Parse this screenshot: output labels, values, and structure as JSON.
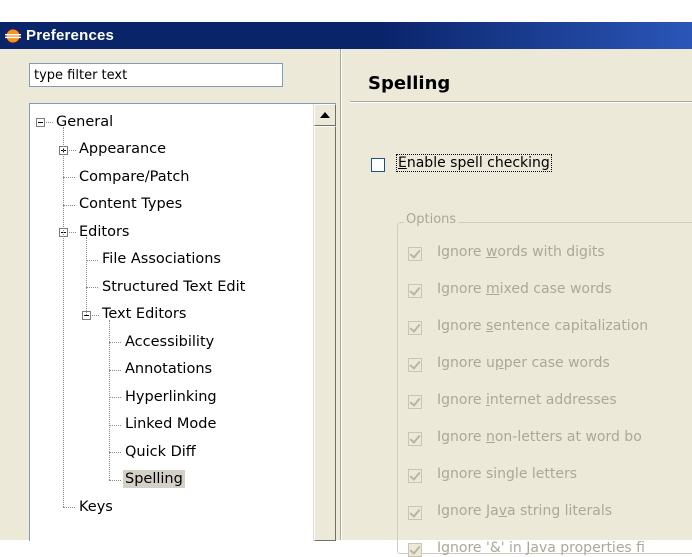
{
  "window": {
    "title": "Preferences",
    "icon": "eclipse-icon"
  },
  "filter": {
    "value": "type filter text"
  },
  "tree": [
    {
      "label": "General",
      "expander": "minus",
      "indent": 0
    },
    {
      "label": "Appearance",
      "expander": "plus",
      "indent": 1
    },
    {
      "label": "Compare/Patch",
      "expander": "none",
      "indent": 1
    },
    {
      "label": "Content Types",
      "expander": "none",
      "indent": 1
    },
    {
      "label": "Editors",
      "expander": "minus",
      "indent": 1
    },
    {
      "label": "File Associations",
      "expander": "none",
      "indent": 2
    },
    {
      "label": "Structured Text Edit",
      "expander": "none",
      "indent": 2
    },
    {
      "label": "Text Editors",
      "expander": "minus",
      "indent": 2
    },
    {
      "label": "Accessibility",
      "expander": "none",
      "indent": 3
    },
    {
      "label": "Annotations",
      "expander": "none",
      "indent": 3
    },
    {
      "label": "Hyperlinking",
      "expander": "none",
      "indent": 3
    },
    {
      "label": "Linked Mode",
      "expander": "none",
      "indent": 3
    },
    {
      "label": "Quick Diff",
      "expander": "none",
      "indent": 3
    },
    {
      "label": "Spelling",
      "expander": "none",
      "indent": 3,
      "selected": true
    },
    {
      "label": "Keys",
      "expander": "none",
      "indent": 1
    }
  ],
  "page": {
    "title": "Spelling",
    "enable": {
      "label": "Enable spell checking",
      "mnemonic": "E",
      "checked": false
    },
    "options_group": "Options",
    "options": [
      {
        "pre": "Ignore ",
        "mn": "w",
        "post": "ords with digits",
        "checked": true
      },
      {
        "pre": "Ignore ",
        "mn": "m",
        "post": "ixed case words",
        "checked": true
      },
      {
        "pre": "Ignore ",
        "mn": "s",
        "post": "entence capitalization",
        "checked": true
      },
      {
        "pre": "Ignore u",
        "mn": "p",
        "post": "per case words",
        "checked": true
      },
      {
        "pre": "Ignore ",
        "mn": "i",
        "post": "nternet addresses",
        "checked": true
      },
      {
        "pre": "Ignore ",
        "mn": "n",
        "post": "on-letters at word bo",
        "checked": true
      },
      {
        "pre": "I",
        "mn": "g",
        "post": "nore single letters",
        "checked": true
      },
      {
        "pre": "Ignore Ja",
        "mn": "v",
        "post": "a string literals",
        "checked": true
      },
      {
        "pre": "Ignore '&' in ",
        "mn": "J",
        "post": "ava properties fi",
        "checked": true
      }
    ]
  },
  "colors": {
    "titlebar": "#0a246a",
    "dialog_bg": "#ece9d8",
    "disabled_text": "#aca899",
    "selection": "#d4d0c8"
  }
}
